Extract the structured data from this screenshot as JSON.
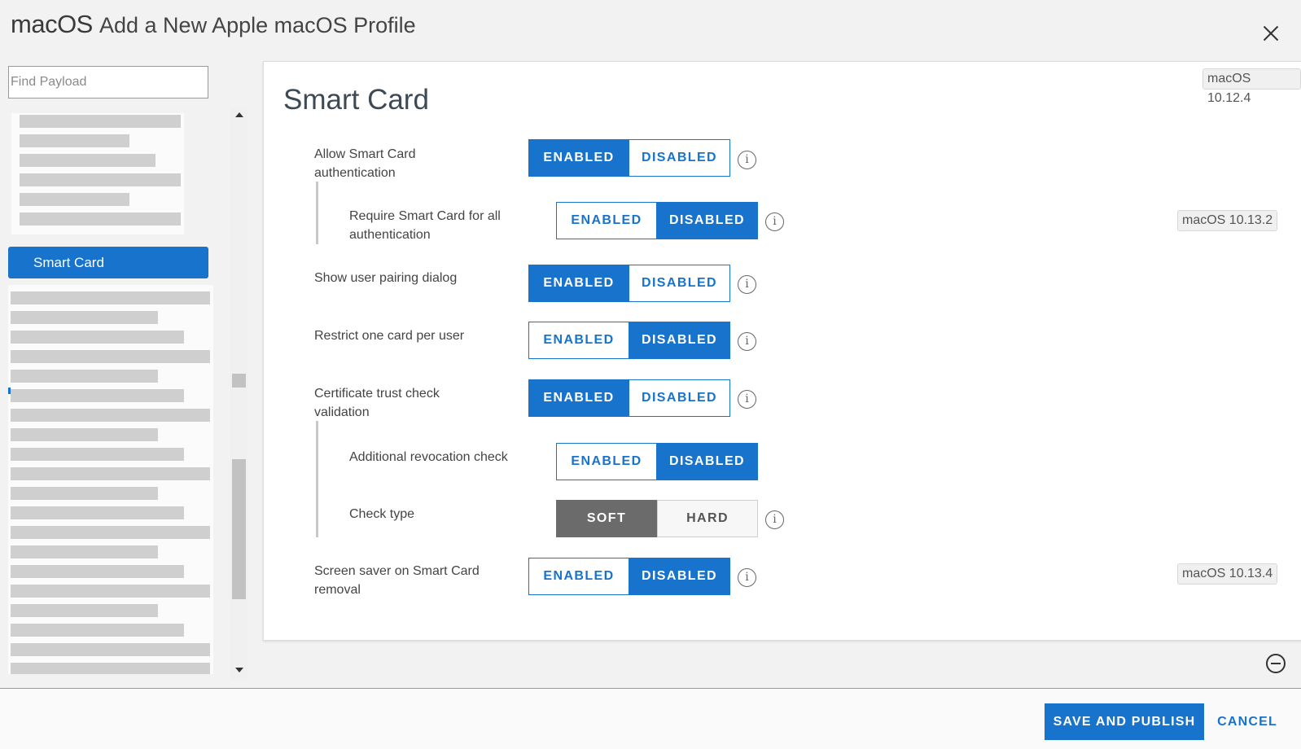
{
  "header": {
    "brand": "macOS",
    "title": "Add a New Apple macOS Profile",
    "close_icon": "close-icon"
  },
  "sidebar": {
    "search_placeholder": "Find Payload",
    "active_item": "Smart Card"
  },
  "payload": {
    "title": "Smart Card",
    "version_badge": "macOS 10.12.4",
    "settings": [
      {
        "label": "Allow Smart Card authentication",
        "options": [
          "ENABLED",
          "DISABLED"
        ],
        "selected": "ENABLED"
      },
      {
        "label": "Require Smart Card for all authentication",
        "options": [
          "ENABLED",
          "DISABLED"
        ],
        "selected": "DISABLED",
        "version": "macOS 10.13.2"
      },
      {
        "label": "Show user pairing dialog",
        "options": [
          "ENABLED",
          "DISABLED"
        ],
        "selected": "ENABLED"
      },
      {
        "label": "Restrict one card per user",
        "options": [
          "ENABLED",
          "DISABLED"
        ],
        "selected": "DISABLED"
      },
      {
        "label": "Certificate trust check validation",
        "options": [
          "ENABLED",
          "DISABLED"
        ],
        "selected": "ENABLED"
      },
      {
        "label": "Additional revocation check",
        "options": [
          "ENABLED",
          "DISABLED"
        ],
        "selected": "DISABLED"
      },
      {
        "label": "Check type",
        "options": [
          "SOFT",
          "HARD"
        ],
        "selected": "SOFT"
      },
      {
        "label": "Screen saver on Smart Card removal",
        "options": [
          "ENABLED",
          "DISABLED"
        ],
        "selected": "DISABLED",
        "version": "macOS 10.13.4"
      }
    ],
    "info_glyph": "i"
  },
  "footer": {
    "save_label": "SAVE AND PUBLISH",
    "cancel_label": "CANCEL"
  },
  "colors": {
    "accent": "#1873cc",
    "selected_grey": "#6b6b6b"
  }
}
